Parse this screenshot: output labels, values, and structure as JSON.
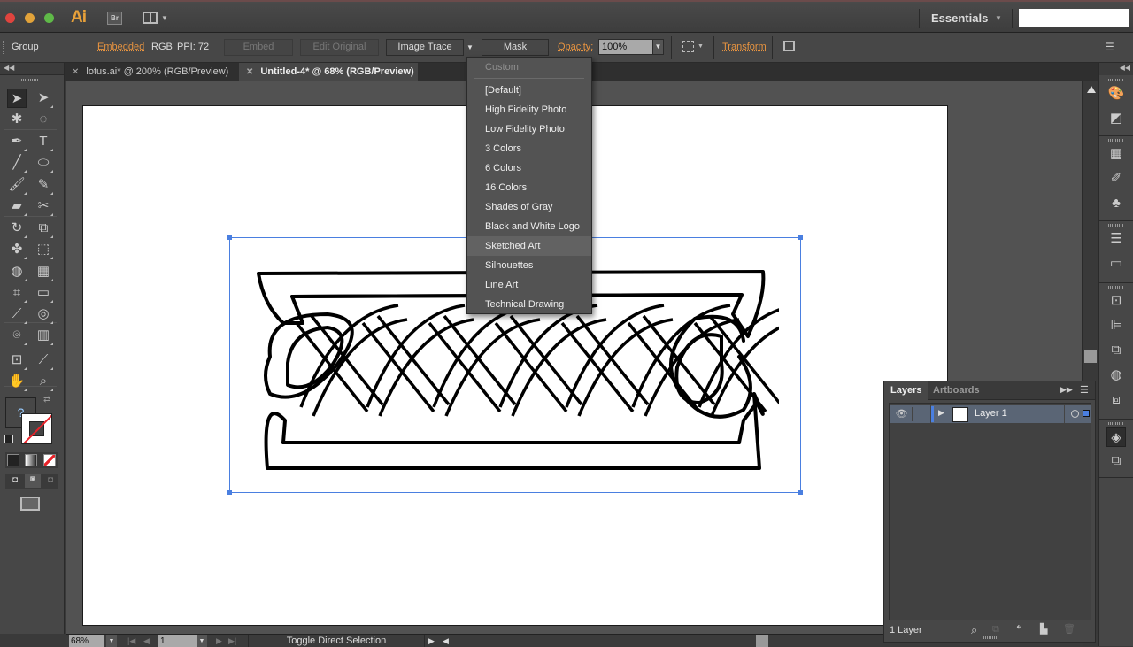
{
  "app": {
    "logo": "Ai",
    "bridge_label": "Br",
    "workspace": "Essentials",
    "search_placeholder": ""
  },
  "control_bar": {
    "selection_type": "Group",
    "embedded_link": "Embedded",
    "color_mode": "RGB",
    "ppi": "PPI: 72",
    "embed_button": "Embed",
    "edit_original_button": "Edit Original",
    "image_trace_button": "Image Trace",
    "mask_button": "Mask",
    "opacity_label": "Opacity:",
    "opacity_value": "100%",
    "transform_link": "Transform"
  },
  "tabs": [
    {
      "label": "lotus.ai* @ 200% (RGB/Preview)",
      "active": false
    },
    {
      "label": "Untitled-4* @ 68% (RGB/Preview)",
      "active": true
    }
  ],
  "image_trace_menu": {
    "items": [
      {
        "label": "Custom",
        "disabled": true
      },
      {
        "label": "[Default]"
      },
      {
        "label": "High Fidelity Photo"
      },
      {
        "label": "Low Fidelity Photo"
      },
      {
        "label": "3 Colors"
      },
      {
        "label": "6 Colors"
      },
      {
        "label": "16 Colors"
      },
      {
        "label": "Shades of Gray"
      },
      {
        "label": "Black and White Logo"
      },
      {
        "label": "Sketched Art",
        "highlighted": true
      },
      {
        "label": "Silhouettes"
      },
      {
        "label": "Line Art"
      },
      {
        "label": "Technical Drawing"
      }
    ]
  },
  "tools": [
    "selection-tool",
    "direct-selection-tool",
    "magic-wand-tool",
    "lasso-tool",
    "pen-tool",
    "type-tool",
    "line-segment-tool",
    "ellipse-tool",
    "paintbrush-tool",
    "pencil-tool",
    "blob-brush-tool",
    "scissors-tool",
    "rotate-tool",
    "scale-tool",
    "puppet-warp-tool",
    "free-transform-tool",
    "shape-builder-tool",
    "perspective-grid-tool",
    "mesh-tool",
    "gradient-tool",
    "eyedropper-tool",
    "blend-tool",
    "symbol-sprayer-tool",
    "column-graph-tool",
    "artboard-tool",
    "slice-tool",
    "hand-tool",
    "zoom-tool"
  ],
  "tool_glyphs": {
    "selection-tool": "➤",
    "direct-selection-tool": "➤",
    "magic-wand-tool": "✱",
    "lasso-tool": "◌",
    "pen-tool": "✒",
    "type-tool": "T",
    "line-segment-tool": "╱",
    "ellipse-tool": "⬭",
    "paintbrush-tool": "🖌",
    "pencil-tool": "✎",
    "blob-brush-tool": "▰",
    "scissors-tool": "✂",
    "rotate-tool": "↻",
    "scale-tool": "⧉",
    "puppet-warp-tool": "✤",
    "free-transform-tool": "⬚",
    "shape-builder-tool": "◍",
    "perspective-grid-tool": "▦",
    "mesh-tool": "⌗",
    "gradient-tool": "▭",
    "eyedropper-tool": "⟋",
    "blend-tool": "◎",
    "symbol-sprayer-tool": "⌾",
    "column-graph-tool": "▥",
    "artboard-tool": "⊡",
    "slice-tool": "⟋",
    "hand-tool": "✋",
    "zoom-tool": "⌕"
  },
  "fill_stroke": {
    "fill_placeholder": "?",
    "stroke_color": "#e8232a"
  },
  "status_bar": {
    "zoom": "68%",
    "artboard": "1",
    "status_text": "Toggle Direct Selection"
  },
  "layers_panel": {
    "tabs": [
      {
        "label": "Layers",
        "active": true
      },
      {
        "label": "Artboards",
        "active": false
      }
    ],
    "layers": [
      {
        "name": "Layer 1",
        "color": "#4a7fe0",
        "visible": true
      }
    ],
    "count_label": "1 Layer"
  },
  "right_dock_icons": [
    "color-icon",
    "color-guide-icon",
    "swatches-icon",
    "brushes-icon",
    "symbols-icon",
    "stroke-icon",
    "gradient-icon",
    "transform-icon",
    "align-icon",
    "pathfinder-icon",
    "appearance-icon",
    "graphic-styles-icon",
    "layers-icon",
    "artboards-icon"
  ],
  "colors": {
    "accent_orange": "#e89440",
    "selection_blue": "#4a7fe0",
    "ai_logo": "#e8a13a"
  }
}
